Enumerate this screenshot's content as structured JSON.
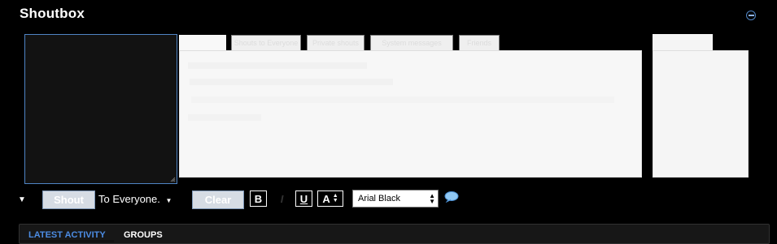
{
  "shoutbox": {
    "title": "Shoutbox",
    "tabs": [
      {
        "label": "",
        "active": true
      },
      {
        "label": "Shouts to Everyone",
        "active": false
      },
      {
        "label": "Private shouts",
        "active": false
      },
      {
        "label": "System messages",
        "active": false
      },
      {
        "label": "Friends",
        "active": false
      }
    ],
    "send_button": "Shout",
    "recipient": "To Everyone.",
    "clear_button": "Clear",
    "format": {
      "bold": "B",
      "italic": "I",
      "underline": "U",
      "color": "A"
    },
    "font_select": {
      "value": "Arial Black"
    }
  },
  "activity_tabs": [
    {
      "label": "Latest Activity",
      "active": true
    },
    {
      "label": "Groups",
      "active": false
    }
  ],
  "colors": {
    "background": "#000000",
    "accent": "#4c8ce3",
    "panel": "#f7f7f7"
  },
  "icons": {
    "collapse": "minus-circle-icon",
    "smiley": "speech-bubble-icon"
  }
}
